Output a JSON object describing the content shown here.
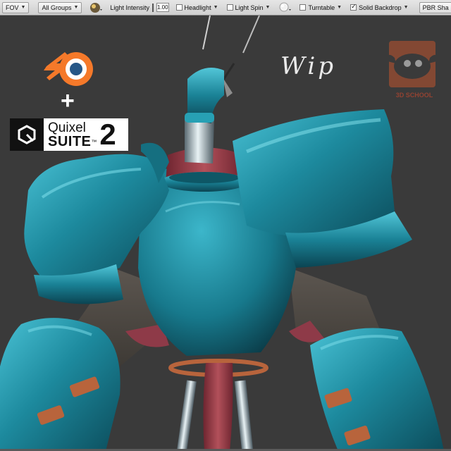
{
  "toolbar": {
    "fov_label": "FOV",
    "groups_value": "All Groups",
    "light_intensity_label": "Light Intensity",
    "light_intensity_value": "1.00",
    "headlight_label": "Headlight",
    "light_spin_label": "Light Spin",
    "turntable_label": "Turntable",
    "solid_backdrop_label": "Solid Backdrop",
    "pbr_label": "PBR Sha",
    "headlight_checked": false,
    "light_spin_checked": false,
    "turntable_checked": false,
    "solid_backdrop_checked": true
  },
  "overlay": {
    "plus_sign": "+",
    "quixel_name": "Quixel",
    "quixel_suite": "SUITE",
    "quixel_version": "2",
    "quixel_tm": "™",
    "wip_text": "Wip",
    "school_name": "3D SCHOOL"
  },
  "colors": {
    "viewport_bg": "#3a3a3a",
    "armor_teal": "#1d8a9e",
    "cloth_red": "#9b3a44",
    "copper": "#b8643c",
    "blender_orange": "#f5792a",
    "blender_blue": "#265787"
  }
}
